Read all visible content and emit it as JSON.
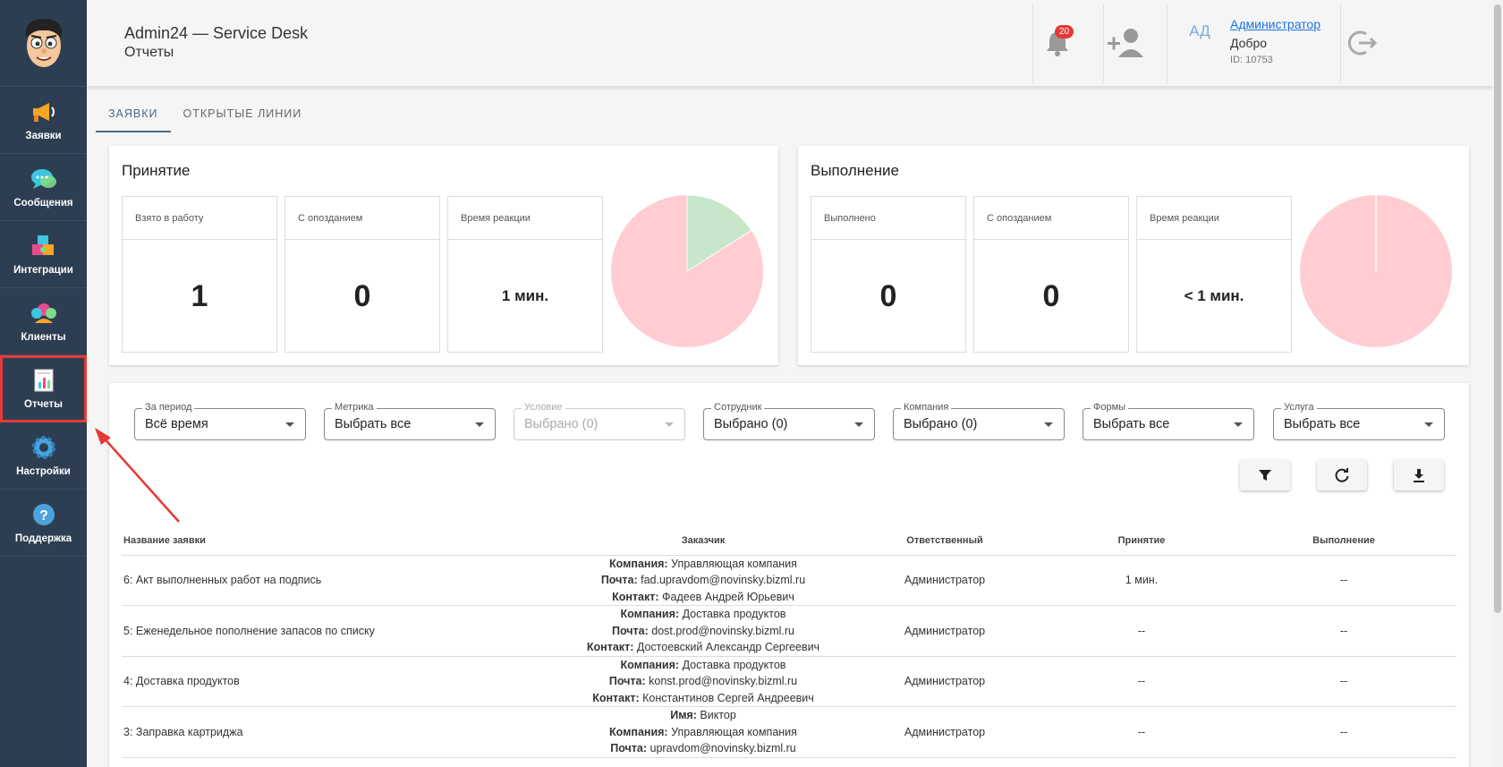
{
  "sidebar": {
    "items": [
      {
        "label": "Заявки",
        "icon": "megaphone-icon"
      },
      {
        "label": "Сообщения",
        "icon": "chat-bubbles-icon"
      },
      {
        "label": "Интеграции",
        "icon": "puzzle-icon"
      },
      {
        "label": "Клиенты",
        "icon": "users-group-icon"
      },
      {
        "label": "Отчеты",
        "icon": "report-chart-icon",
        "active": true
      },
      {
        "label": "Настройки",
        "icon": "gear-icon"
      },
      {
        "label": "Поддержка",
        "icon": "help-icon"
      }
    ]
  },
  "header": {
    "title": "Admin24 — Service Desk",
    "subtitle": "Отчеты",
    "notifications_count": "20",
    "avatar_initials": "АД",
    "user_name": "Администратор",
    "greeting": "Добро",
    "user_id": "ID: 10753"
  },
  "tabs": [
    {
      "label": "ЗАЯВКИ",
      "active": true
    },
    {
      "label": "ОТКРЫТЫЕ ЛИНИИ"
    }
  ],
  "acceptance": {
    "title": "Принятие",
    "stats": [
      {
        "label": "Взято в работу",
        "value": "1"
      },
      {
        "label": "С опозданием",
        "value": "0"
      },
      {
        "label": "Время реакции",
        "value": "1 мин."
      }
    ],
    "pie": {
      "ontime_fraction": 0.16,
      "late_color": "#ffcdd2",
      "ontime_color": "#c8e6c9"
    }
  },
  "completion": {
    "title": "Выполнение",
    "stats": [
      {
        "label": "Выполнено",
        "value": "0"
      },
      {
        "label": "С опозданием",
        "value": "0"
      },
      {
        "label": "Время реакции",
        "value": "< 1 мин."
      }
    ],
    "pie": {
      "ontime_fraction": 0.0,
      "late_color": "#ffcdd2",
      "ontime_color": "#c8e6c9"
    }
  },
  "filters": [
    {
      "label": "За период",
      "value": "Всё время"
    },
    {
      "label": "Метрика",
      "value": "Выбрать все"
    },
    {
      "label": "Условие",
      "value": "Выбрано (0)",
      "disabled": true
    },
    {
      "label": "Сотрудник",
      "value": "Выбрано (0)"
    },
    {
      "label": "Компания",
      "value": "Выбрано (0)"
    },
    {
      "label": "Формы",
      "value": "Выбрать все"
    },
    {
      "label": "Услуга",
      "value": "Выбрать все"
    }
  ],
  "actions": [
    {
      "name": "filter-button",
      "icon": "filter-icon"
    },
    {
      "name": "refresh-button",
      "icon": "refresh-icon"
    },
    {
      "name": "download-button",
      "icon": "download-icon"
    }
  ],
  "table": {
    "columns": [
      "Название заявки",
      "Заказчик",
      "Ответственный",
      "Принятие",
      "Выполнение"
    ],
    "rows": [
      {
        "name": "6: Акт выполненных работ на подпись",
        "customer": [
          [
            "Компания:",
            "Управляющая компания"
          ],
          [
            "Почта:",
            "fad.upravdom@novinsky.bizml.ru"
          ],
          [
            "Контакт:",
            "Фадеев Андрей Юрьевич"
          ]
        ],
        "responsible": "Администратор",
        "accept": "1 мин.",
        "complete": "--"
      },
      {
        "name": "5: Еженедельное пополнение запасов по списку",
        "customer": [
          [
            "Компания:",
            "Доставка продуктов"
          ],
          [
            "Почта:",
            "dost.prod@novinsky.bizml.ru"
          ],
          [
            "Контакт:",
            "Достоевский Александр Сергеевич"
          ]
        ],
        "responsible": "Администратор",
        "accept": "--",
        "complete": "--"
      },
      {
        "name": "4: Доставка продуктов",
        "customer": [
          [
            "Компания:",
            "Доставка продуктов"
          ],
          [
            "Почта:",
            "konst.prod@novinsky.bizml.ru"
          ],
          [
            "Контакт:",
            "Константинов Сергей Андреевич"
          ]
        ],
        "responsible": "Администратор",
        "accept": "--",
        "complete": "--"
      },
      {
        "name": "3: Заправка картриджа",
        "customer": [
          [
            "Имя:",
            "Виктор"
          ],
          [
            "Компания:",
            "Управляющая компания"
          ],
          [
            "Почта:",
            "upravdom@novinsky.bizml.ru"
          ]
        ],
        "responsible": "Администратор",
        "accept": "--",
        "complete": "--"
      }
    ]
  }
}
